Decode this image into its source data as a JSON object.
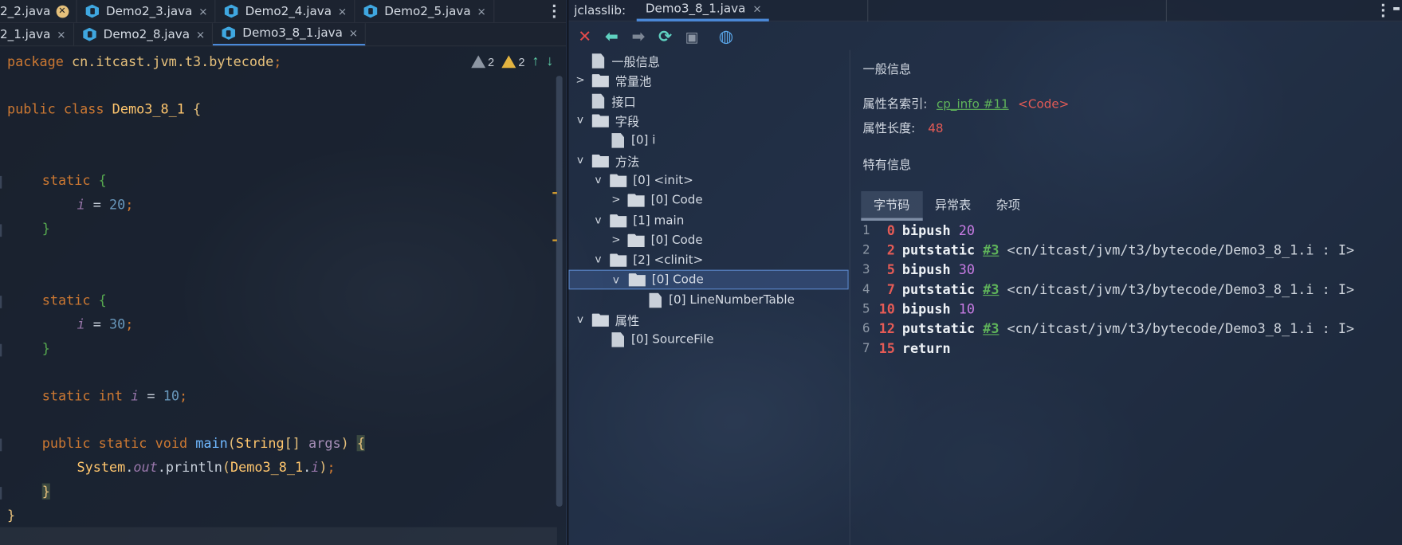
{
  "editor": {
    "tabs_row1": [
      {
        "label": "2_2.java",
        "close": "×",
        "modified": true
      },
      {
        "label": "Demo2_3.java",
        "close": "×"
      },
      {
        "label": "Demo2_4.java",
        "close": "×"
      },
      {
        "label": "Demo2_5.java",
        "close": "×"
      }
    ],
    "tabs_row2": [
      {
        "label": "2_1.java",
        "close": "×"
      },
      {
        "label": "Demo2_8.java",
        "close": "×"
      },
      {
        "label": "Demo3_8_1.java",
        "close": "×",
        "active": true
      }
    ],
    "inspections": {
      "warnings_gray": "2",
      "warnings_yellow": "2"
    },
    "code": {
      "package_kw": "package",
      "package_name": "cn.itcast.jvm.t3.bytecode",
      "semi": ";",
      "public_kw": "public",
      "class_kw": "class",
      "class_name": "Demo3_8_1",
      "brace_open": "{",
      "brace_close": "}",
      "static_kw": "static",
      "field_i": "i",
      "eq": "=",
      "v20": "20",
      "v30": "30",
      "v10": "10",
      "int_kw": "int",
      "void_kw": "void",
      "main_name": "main",
      "main_sig_open": "(",
      "string_type": "String",
      "arr": "[]",
      "args": "args",
      "main_sig_close": ")",
      "system": "System",
      "dot": ".",
      "out": "out",
      "println": "println",
      "paren_open": "(",
      "paren_close": ")"
    }
  },
  "jclasslib": {
    "label": "jclasslib:",
    "tab": "Demo3_8_1.java",
    "tab_close": "×",
    "tree": [
      {
        "label": "一般信息",
        "kind": "doc"
      },
      {
        "label": "常量池",
        "kind": "folder",
        "chev": "›"
      },
      {
        "label": "接口",
        "kind": "doc"
      },
      {
        "label": "字段",
        "kind": "folder",
        "chev": "⌄"
      },
      {
        "label": "[0] i",
        "kind": "doc"
      },
      {
        "label": "方法",
        "kind": "folder",
        "chev": "⌄"
      },
      {
        "label": "[0] <init>",
        "kind": "folder",
        "chev": "⌄"
      },
      {
        "label": "[0] Code",
        "kind": "folder",
        "chev": "›"
      },
      {
        "label": "[1] main",
        "kind": "folder",
        "chev": "⌄"
      },
      {
        "label": "[0] Code",
        "kind": "folder",
        "chev": "›"
      },
      {
        "label": "[2] <clinit>",
        "kind": "folder",
        "chev": "⌄"
      },
      {
        "label": "[0] Code",
        "kind": "folder",
        "chev": "⌄",
        "selected": true
      },
      {
        "label": "[0] LineNumberTable",
        "kind": "doc"
      },
      {
        "label": "属性",
        "kind": "folder",
        "chev": "⌄"
      },
      {
        "label": "[0] SourceFile",
        "kind": "doc"
      }
    ],
    "detail": {
      "general_heading": "一般信息",
      "name_index_label": "属性名索引:",
      "name_index_link": "cp_info #11",
      "name_index_value": "<Code>",
      "length_label": "属性长度:",
      "length_value": "48",
      "specific_heading": "特有信息",
      "tabs": [
        "字节码",
        "异常表",
        "杂项"
      ]
    },
    "bytecode": [
      {
        "line": "1",
        "offset": "0",
        "op": "bipush",
        "arg": "20"
      },
      {
        "line": "2",
        "offset": "2",
        "op": "putstatic",
        "ref": "#3",
        "comment": "<cn/itcast/jvm/t3/bytecode/Demo3_8_1.i : I>"
      },
      {
        "line": "3",
        "offset": "5",
        "op": "bipush",
        "arg": "30"
      },
      {
        "line": "4",
        "offset": "7",
        "op": "putstatic",
        "ref": "#3",
        "comment": "<cn/itcast/jvm/t3/bytecode/Demo3_8_1.i : I>"
      },
      {
        "line": "5",
        "offset": "10",
        "op": "bipush",
        "arg": "10"
      },
      {
        "line": "6",
        "offset": "12",
        "op": "putstatic",
        "ref": "#3",
        "comment": "<cn/itcast/jvm/t3/bytecode/Demo3_8_1.i : I>"
      },
      {
        "line": "7",
        "offset": "15",
        "op": "return"
      }
    ]
  }
}
